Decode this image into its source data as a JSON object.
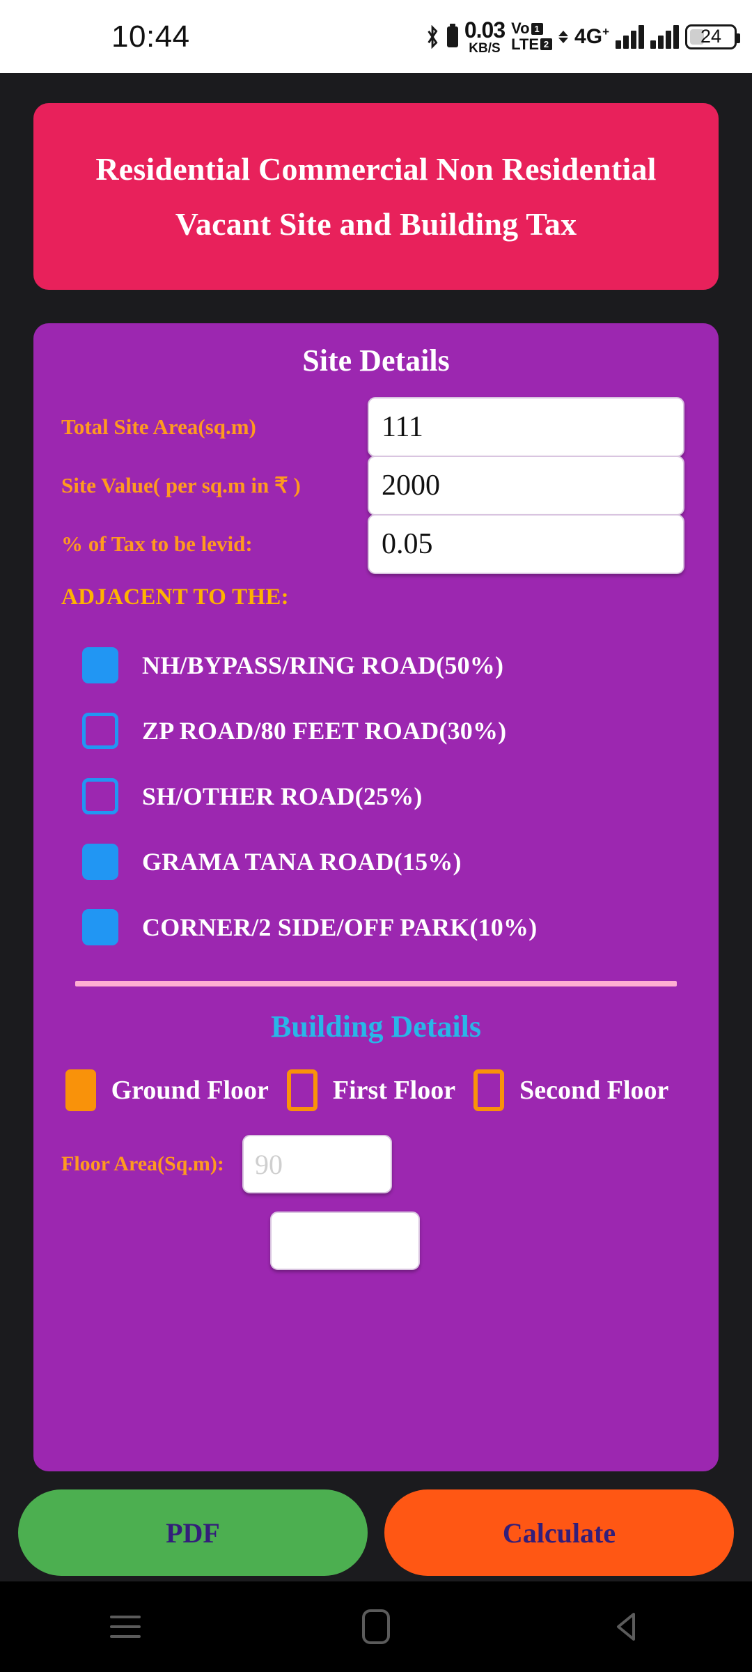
{
  "statusbar": {
    "time": "10:44",
    "net_speed_value": "0.03",
    "net_speed_unit": "KB/S",
    "volte_line1": "Vo",
    "volte_line2": "LTE",
    "sim1": "1",
    "sim2": "2",
    "network_type": "4G",
    "network_plus": "+",
    "battery_level": "24",
    "icons": [
      "bluetooth-icon",
      "battery-icon",
      "signal-icon",
      "signal-icon",
      "battery-icon"
    ]
  },
  "header": {
    "title": "Residential Commercial Non Residential Vacant Site and Building Tax"
  },
  "site_details": {
    "title": "Site Details",
    "fields": [
      {
        "label": "Total Site Area(sq.m)",
        "value": "111"
      },
      {
        "label": "Site Value( per sq.m in ₹ )",
        "value": "2000"
      },
      {
        "label": "% of Tax to be levid:",
        "value": "0.05"
      }
    ],
    "adjacent_heading": "ADJACENT TO THE:",
    "adjacent_options": [
      {
        "label": "NH/BYPASS/RING ROAD(50%)",
        "checked": true
      },
      {
        "label": "ZP ROAD/80 FEET ROAD(30%)",
        "checked": false
      },
      {
        "label": "SH/OTHER ROAD(25%)",
        "checked": false
      },
      {
        "label": "GRAMA TANA ROAD(15%)",
        "checked": true
      },
      {
        "label": "CORNER/2 SIDE/OFF PARK(10%)",
        "checked": true
      }
    ]
  },
  "building_details": {
    "title": "Building Details",
    "floors": [
      {
        "label": "Ground Floor",
        "checked": true
      },
      {
        "label": "First Floor",
        "checked": false
      },
      {
        "label": "Second Floor",
        "checked": false
      }
    ],
    "floor_area_label": "Floor Area(Sq.m):",
    "floor_area_placeholder": "90",
    "floor_area_value": ""
  },
  "buttons": {
    "pdf": "PDF",
    "calculate": "Calculate"
  },
  "navbar": {
    "recents": "recents-icon",
    "home": "home-icon",
    "back": "back-icon"
  },
  "colors": {
    "header_pink": "#e8215b",
    "card_purple": "#9c27b0",
    "label_orange": "#ff9a1f",
    "checkbox_blue": "#2196f3",
    "floor_orange": "#f9920a",
    "building_cyan": "#29b6e8",
    "pdf_green": "#4caf50",
    "calculate_orange": "#ff5714",
    "divider_pink": "#ffaed3",
    "page_background": "#1b1b1e"
  }
}
